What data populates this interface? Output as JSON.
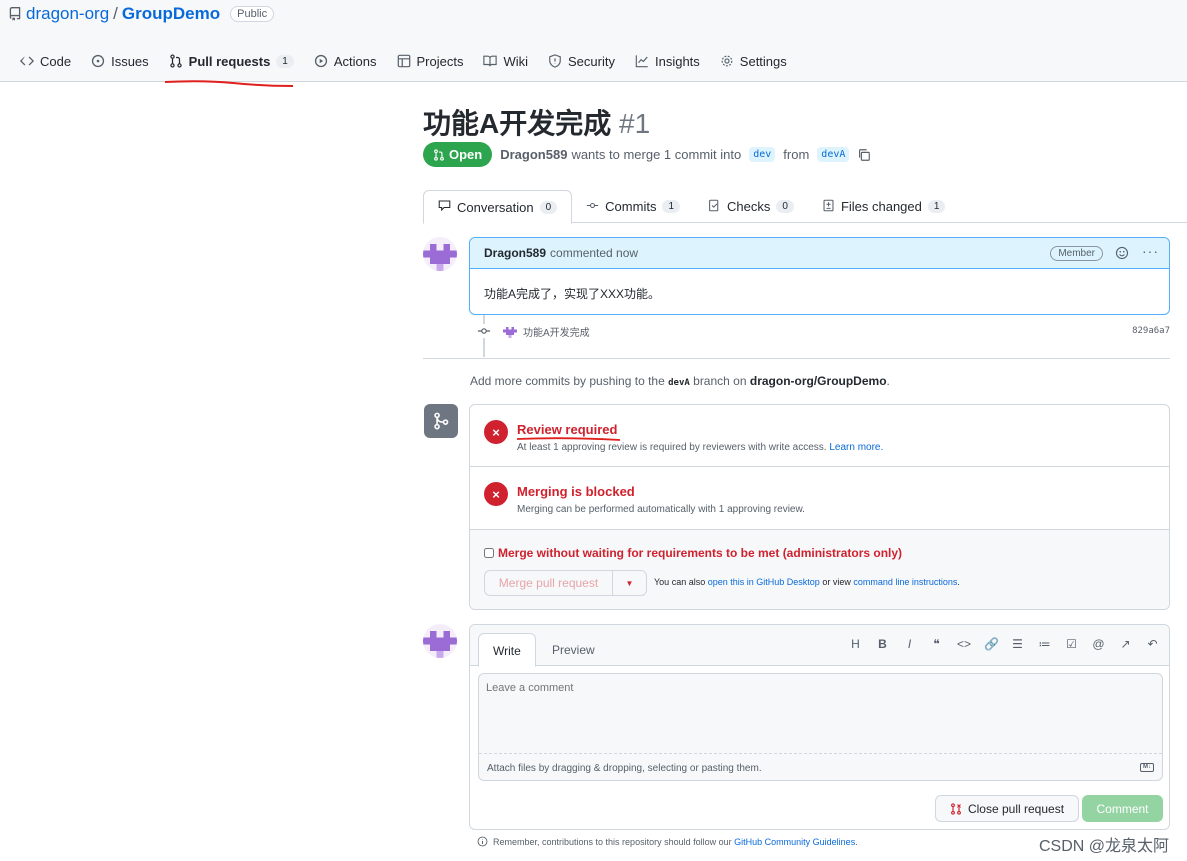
{
  "repo": {
    "owner": "dragon-org",
    "separator": "/",
    "name": "GroupDemo",
    "visibility": "Public"
  },
  "nav": {
    "items": [
      {
        "label": "Code",
        "icon": "code-icon"
      },
      {
        "label": "Issues",
        "icon": "issue-icon"
      },
      {
        "label": "Pull requests",
        "icon": "pull-request-icon",
        "count": "1",
        "active": true
      },
      {
        "label": "Actions",
        "icon": "play-icon"
      },
      {
        "label": "Projects",
        "icon": "table-icon"
      },
      {
        "label": "Wiki",
        "icon": "book-icon"
      },
      {
        "label": "Security",
        "icon": "shield-icon"
      },
      {
        "label": "Insights",
        "icon": "graph-icon"
      },
      {
        "label": "Settings",
        "icon": "gear-icon"
      }
    ]
  },
  "pr": {
    "title": "功能A开发完成",
    "number": "#1",
    "state": "Open",
    "author": "Dragon589",
    "merge_text": "wants to merge 1 commit into",
    "base_branch": "dev",
    "from_text": "from",
    "head_branch": "devA"
  },
  "tabs": [
    {
      "label": "Conversation",
      "count": "0",
      "icon": "comment-icon"
    },
    {
      "label": "Commits",
      "count": "1",
      "icon": "commit-icon"
    },
    {
      "label": "Checks",
      "count": "0",
      "icon": "checklist-icon"
    },
    {
      "label": "Files changed",
      "count": "1",
      "icon": "file-diff-icon"
    }
  ],
  "comment": {
    "author": "Dragon589",
    "time": "commented now",
    "role": "Member",
    "body": "功能A完成了，实现了XXX功能。"
  },
  "commit": {
    "message": "功能A开发完成",
    "sha": "829a6a7"
  },
  "push_note": {
    "prefix": "Add more commits by pushing to the",
    "branch": "devA",
    "middle": "branch on",
    "repo": "dragon-org/GroupDemo",
    "suffix": "."
  },
  "merge": {
    "review_title": "Review required",
    "review_desc": "At least 1 approving review is required by reviewers with write access.",
    "learn_more": "Learn more.",
    "blocked_title": "Merging is blocked",
    "blocked_desc": "Merging can be performed automatically with 1 approving review.",
    "bypass_label": "Merge without waiting for requirements to be met (administrators only)",
    "merge_button": "Merge pull request",
    "also_prefix": "You can also",
    "desktop_link": "open this in GitHub Desktop",
    "also_middle": "or view",
    "cli_link": "command line instructions",
    "also_suffix": "."
  },
  "compose": {
    "write_tab": "Write",
    "preview_tab": "Preview",
    "toolbar": [
      "H",
      "B",
      "I",
      "❝",
      "<>",
      "🔗",
      "☰",
      "≔",
      "☑",
      "@",
      "↗",
      "↶"
    ],
    "placeholder": "Leave a comment",
    "attach_text": "Attach files by dragging & dropping, selecting or pasting them.",
    "close_button": "Close pull request",
    "comment_button": "Comment"
  },
  "guidelines": {
    "prefix": "Remember, contributions to this repository should follow our",
    "link": "GitHub Community Guidelines",
    "suffix": "."
  },
  "watermark": "CSDN @龙泉太阿",
  "colors": {
    "accent": "#0969da",
    "open": "#2da44e",
    "danger": "#cf222e",
    "comment_disabled": "#94d3a2"
  }
}
